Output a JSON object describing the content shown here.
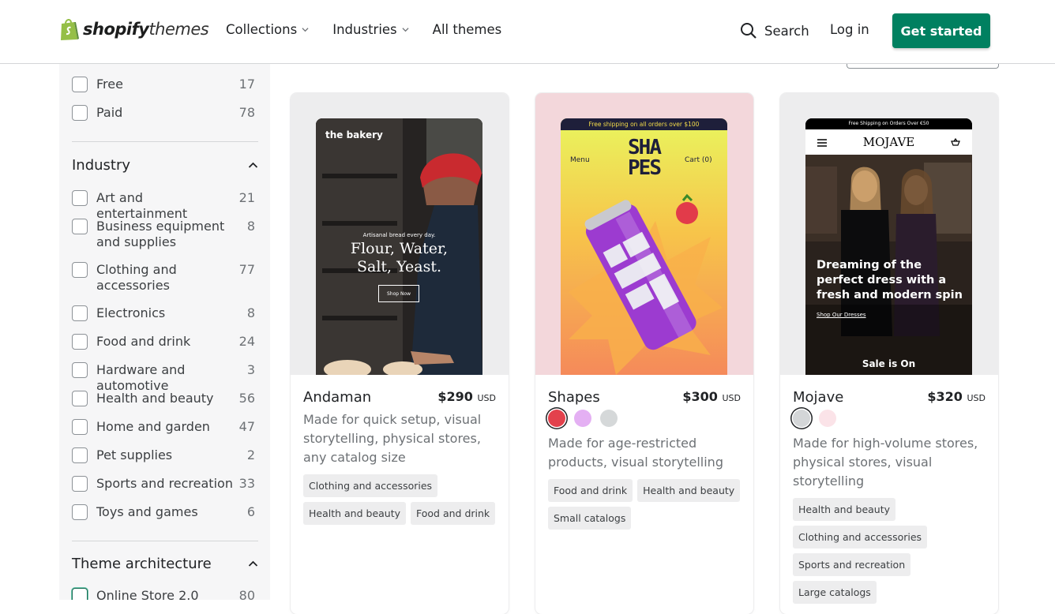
{
  "header": {
    "logo_bold": "shopify",
    "logo_light": "themes",
    "nav": [
      {
        "label": "Collections",
        "dropdown": true
      },
      {
        "label": "Industries",
        "dropdown": true
      },
      {
        "label": "All themes",
        "dropdown": false
      }
    ],
    "search_label": "Search",
    "login_label": "Log in",
    "cta_label": "Get started"
  },
  "sidebar": {
    "price_filters": [
      {
        "label": "Free",
        "count": "17"
      },
      {
        "label": "Paid",
        "count": "78"
      }
    ],
    "industry": {
      "heading": "Industry",
      "items": [
        {
          "label": "Art and entertainment",
          "count": "21"
        },
        {
          "label": "Business equipment and supplies",
          "count": "8"
        },
        {
          "label": "Clothing and accessories",
          "count": "77"
        },
        {
          "label": "Electronics",
          "count": "8"
        },
        {
          "label": "Food and drink",
          "count": "24"
        },
        {
          "label": "Hardware and automotive",
          "count": "3"
        },
        {
          "label": "Health and beauty",
          "count": "56"
        },
        {
          "label": "Home and garden",
          "count": "47"
        },
        {
          "label": "Pet supplies",
          "count": "2"
        },
        {
          "label": "Sports and recreation",
          "count": "33"
        },
        {
          "label": "Toys and games",
          "count": "6"
        }
      ]
    },
    "architecture": {
      "heading": "Theme architecture",
      "items": [
        {
          "label": "Online Store 2.0",
          "count": "80"
        }
      ]
    }
  },
  "themes": [
    {
      "name": "Andaman",
      "price": "$290",
      "currency": "USD",
      "description": "Made for quick setup, visual storytelling, physical stores, any catalog size",
      "tags": [
        "Clothing and accessories",
        "Health and beauty",
        "Food and drink"
      ],
      "swatches": [],
      "preview": {
        "brand": "the bakery",
        "kicker": "Artisanal bread every day.",
        "headline_1": "Flour, Water,",
        "headline_2": "Salt, Yeast.",
        "button": "Shop Now"
      }
    },
    {
      "name": "Shapes",
      "price": "$300",
      "currency": "USD",
      "description": "Made for age-restricted products, visual storytelling",
      "tags": [
        "Food and drink",
        "Health and beauty",
        "Small catalogs"
      ],
      "swatches": [
        "#e3414c",
        "#e4b0f3",
        "#d5d8d9"
      ],
      "preview": {
        "banner": "Free shipping on all orders over $100",
        "menu": "Menu",
        "logo_1": "SHA",
        "logo_2": "PES",
        "cart": "Cart (0)"
      }
    },
    {
      "name": "Mojave",
      "price": "$320",
      "currency": "USD",
      "description": "Made for high-volume stores, physical stores, visual storytelling",
      "tags": [
        "Health and beauty",
        "Clothing and accessories",
        "Sports and recreation",
        "Large catalogs"
      ],
      "swatches": [
        "#d4d6d8",
        "#fbe3e8"
      ],
      "preview": {
        "banner": "Free Shipping on Orders Over €50",
        "logo": "MOJAVE",
        "headline": "Dreaming of the perfect dress with a fresh and modern spin",
        "link": "Shop Our Dresses",
        "sale": "Sale is On"
      }
    }
  ],
  "colors": {
    "accent": "#008060",
    "sidebar_bg": "#f6f6f7",
    "shapes_card_bg": "#f3d7db",
    "media_bg": "#ededee"
  }
}
